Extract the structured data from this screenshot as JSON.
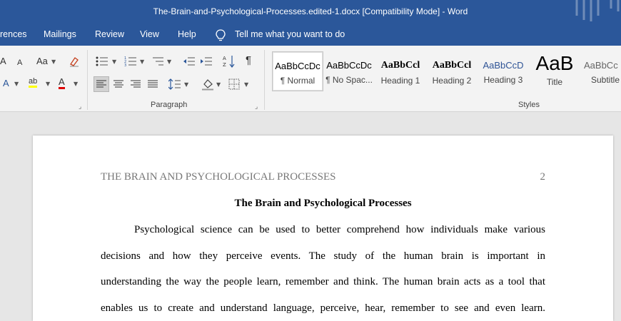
{
  "window": {
    "title": "The-Brain-and-Psychological-Processes.edited-1.docx [Compatibility Mode]  -  Word"
  },
  "ribbon_tabs": [
    "rences",
    "Mailings",
    "Review",
    "View",
    "Help"
  ],
  "tell_me": "Tell me what you want to do",
  "font_group": {
    "grow": "A",
    "shrink": "A",
    "case": "Aa",
    "effects": "A",
    "highlight": "ab",
    "color": "A"
  },
  "paragraph_group": {
    "label": "Paragraph"
  },
  "styles_group": {
    "label": "Styles",
    "items": [
      {
        "sample": "AaBbCcDc",
        "name": "¶ Normal"
      },
      {
        "sample": "AaBbCcDc",
        "name": "¶ No Spac..."
      },
      {
        "sample": "AaBbCcl",
        "name": "Heading 1"
      },
      {
        "sample": "AaBbCcl",
        "name": "Heading 2"
      },
      {
        "sample": "AaBbCcD",
        "name": "Heading 3"
      },
      {
        "sample": "AaB",
        "name": "Title"
      },
      {
        "sample": "AaBbCc",
        "name": "Subtitle"
      }
    ]
  },
  "document": {
    "running_head": "THE BRAIN AND PSYCHOLOGICAL PROCESSES",
    "page_number": "2",
    "title": "The Brain and Psychological Processes",
    "lines": [
      "Psychological science can be used to better comprehend how individuals make various",
      "decisions and how they perceive events. The study of the human brain is important in",
      "understanding the way the people learn, remember and think. The human brain acts as a tool that",
      "enables us to create and understand language, perceive, hear, remember to see and even learn."
    ]
  },
  "colors": {
    "title_bar": "#2b579a",
    "ribbon": "#f3f3f3",
    "canvas": "#e6e6e6"
  }
}
